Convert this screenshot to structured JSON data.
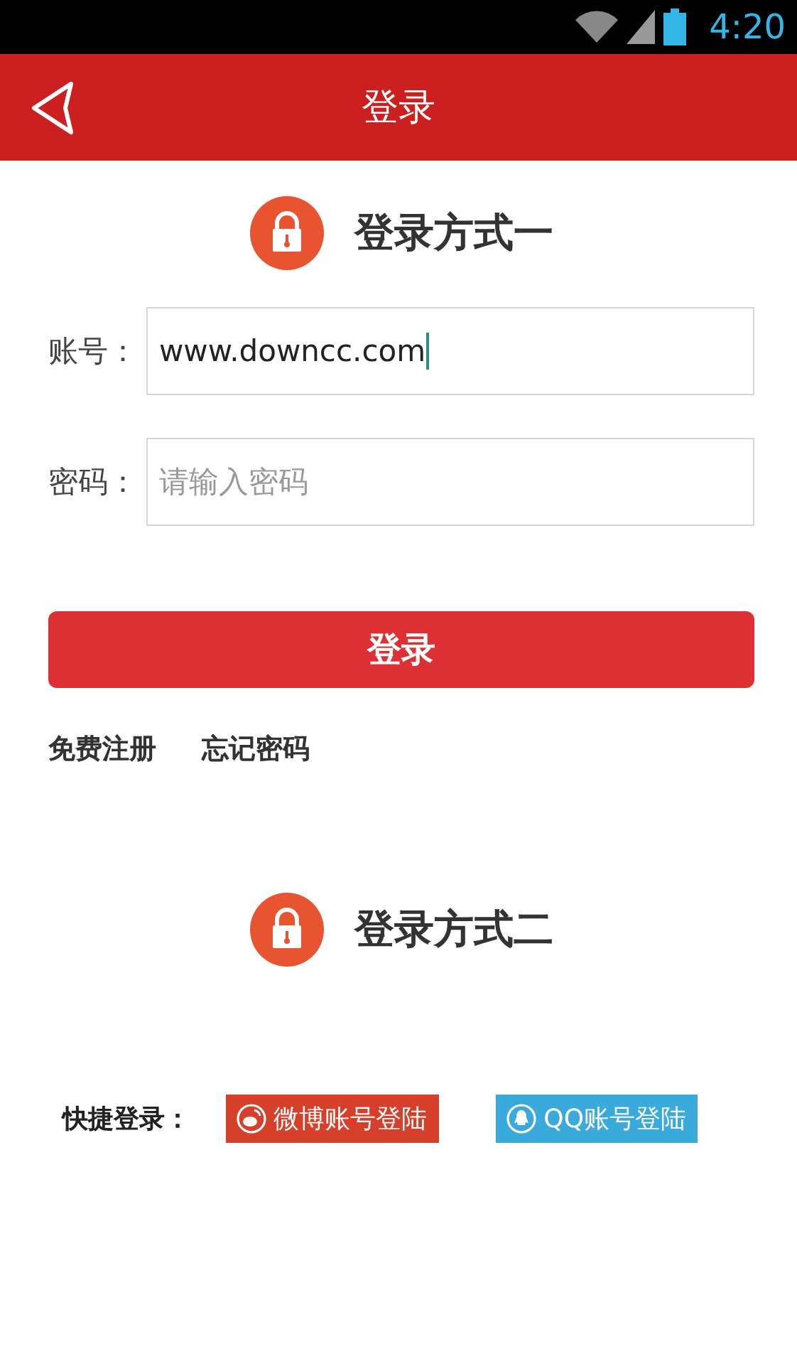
{
  "status_bar": {
    "time": "4:20"
  },
  "header": {
    "title": "登录",
    "back": true
  },
  "sections": [
    {
      "title": "登录方式一"
    },
    {
      "title": "登录方式二"
    }
  ],
  "form": {
    "fields": [
      {
        "label": "账号：",
        "value": "www.downcc.com",
        "focused": true
      },
      {
        "label": "密码：",
        "placeholder": "请输入密码",
        "focused": false
      }
    ],
    "submit": "登录",
    "links": [
      "免费注册",
      "忘记密码"
    ]
  },
  "quick_login": {
    "label": "快捷登录：",
    "buttons": [
      {
        "kind": "weibo",
        "label": "微博账号登陆",
        "color": "#d6402b"
      },
      {
        "kind": "qq",
        "label": "QQ账号登陆",
        "color": "#3aa9dc"
      }
    ]
  }
}
